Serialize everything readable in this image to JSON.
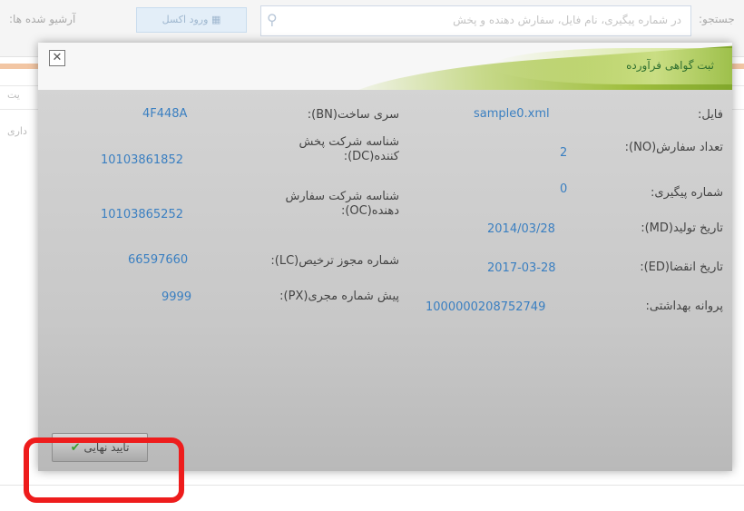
{
  "background": {
    "search_label": "جستجو:",
    "search_placeholder": "در شماره پیگیری، نام فایل، سفارش دهنده و پخش",
    "import_button_label": "ورود اکسل",
    "archived_label": "آرشیو شده ها:",
    "side_text_left": "داری",
    "side_text_right": "یت"
  },
  "modal": {
    "title": "ثبت گواهی فرآورده",
    "right_column": [
      {
        "label": "فایل:",
        "value": "sample0.xml"
      },
      {
        "label": "تعداد سفارش(NO):",
        "value": "2"
      },
      {
        "label": "شماره پیگیری:",
        "value": "0"
      },
      {
        "label": "تاریخ تولید(MD):",
        "value": "2014/03/28"
      },
      {
        "label": "تاریخ انقضا(ED):",
        "value": "2017-03-28"
      },
      {
        "label": "پروانه بهداشتی:",
        "value": "1000000208752749"
      }
    ],
    "left_column": [
      {
        "label": "سری ساخت(BN):",
        "value": "4F448A"
      },
      {
        "label": "شناسه شرکت پخش کننده(DC):",
        "value": "10103861852"
      },
      {
        "label": "شناسه شرکت سفارش دهنده(OC):",
        "value": "10103865252"
      },
      {
        "label": "شماره مجوز ترخیص(LC):",
        "value": "66597660"
      },
      {
        "label": "پیش شماره مجری(PX):",
        "value": "9999"
      }
    ],
    "confirm_button_label": "تایید نهایی",
    "highlight_color": "#ee1c1c"
  }
}
